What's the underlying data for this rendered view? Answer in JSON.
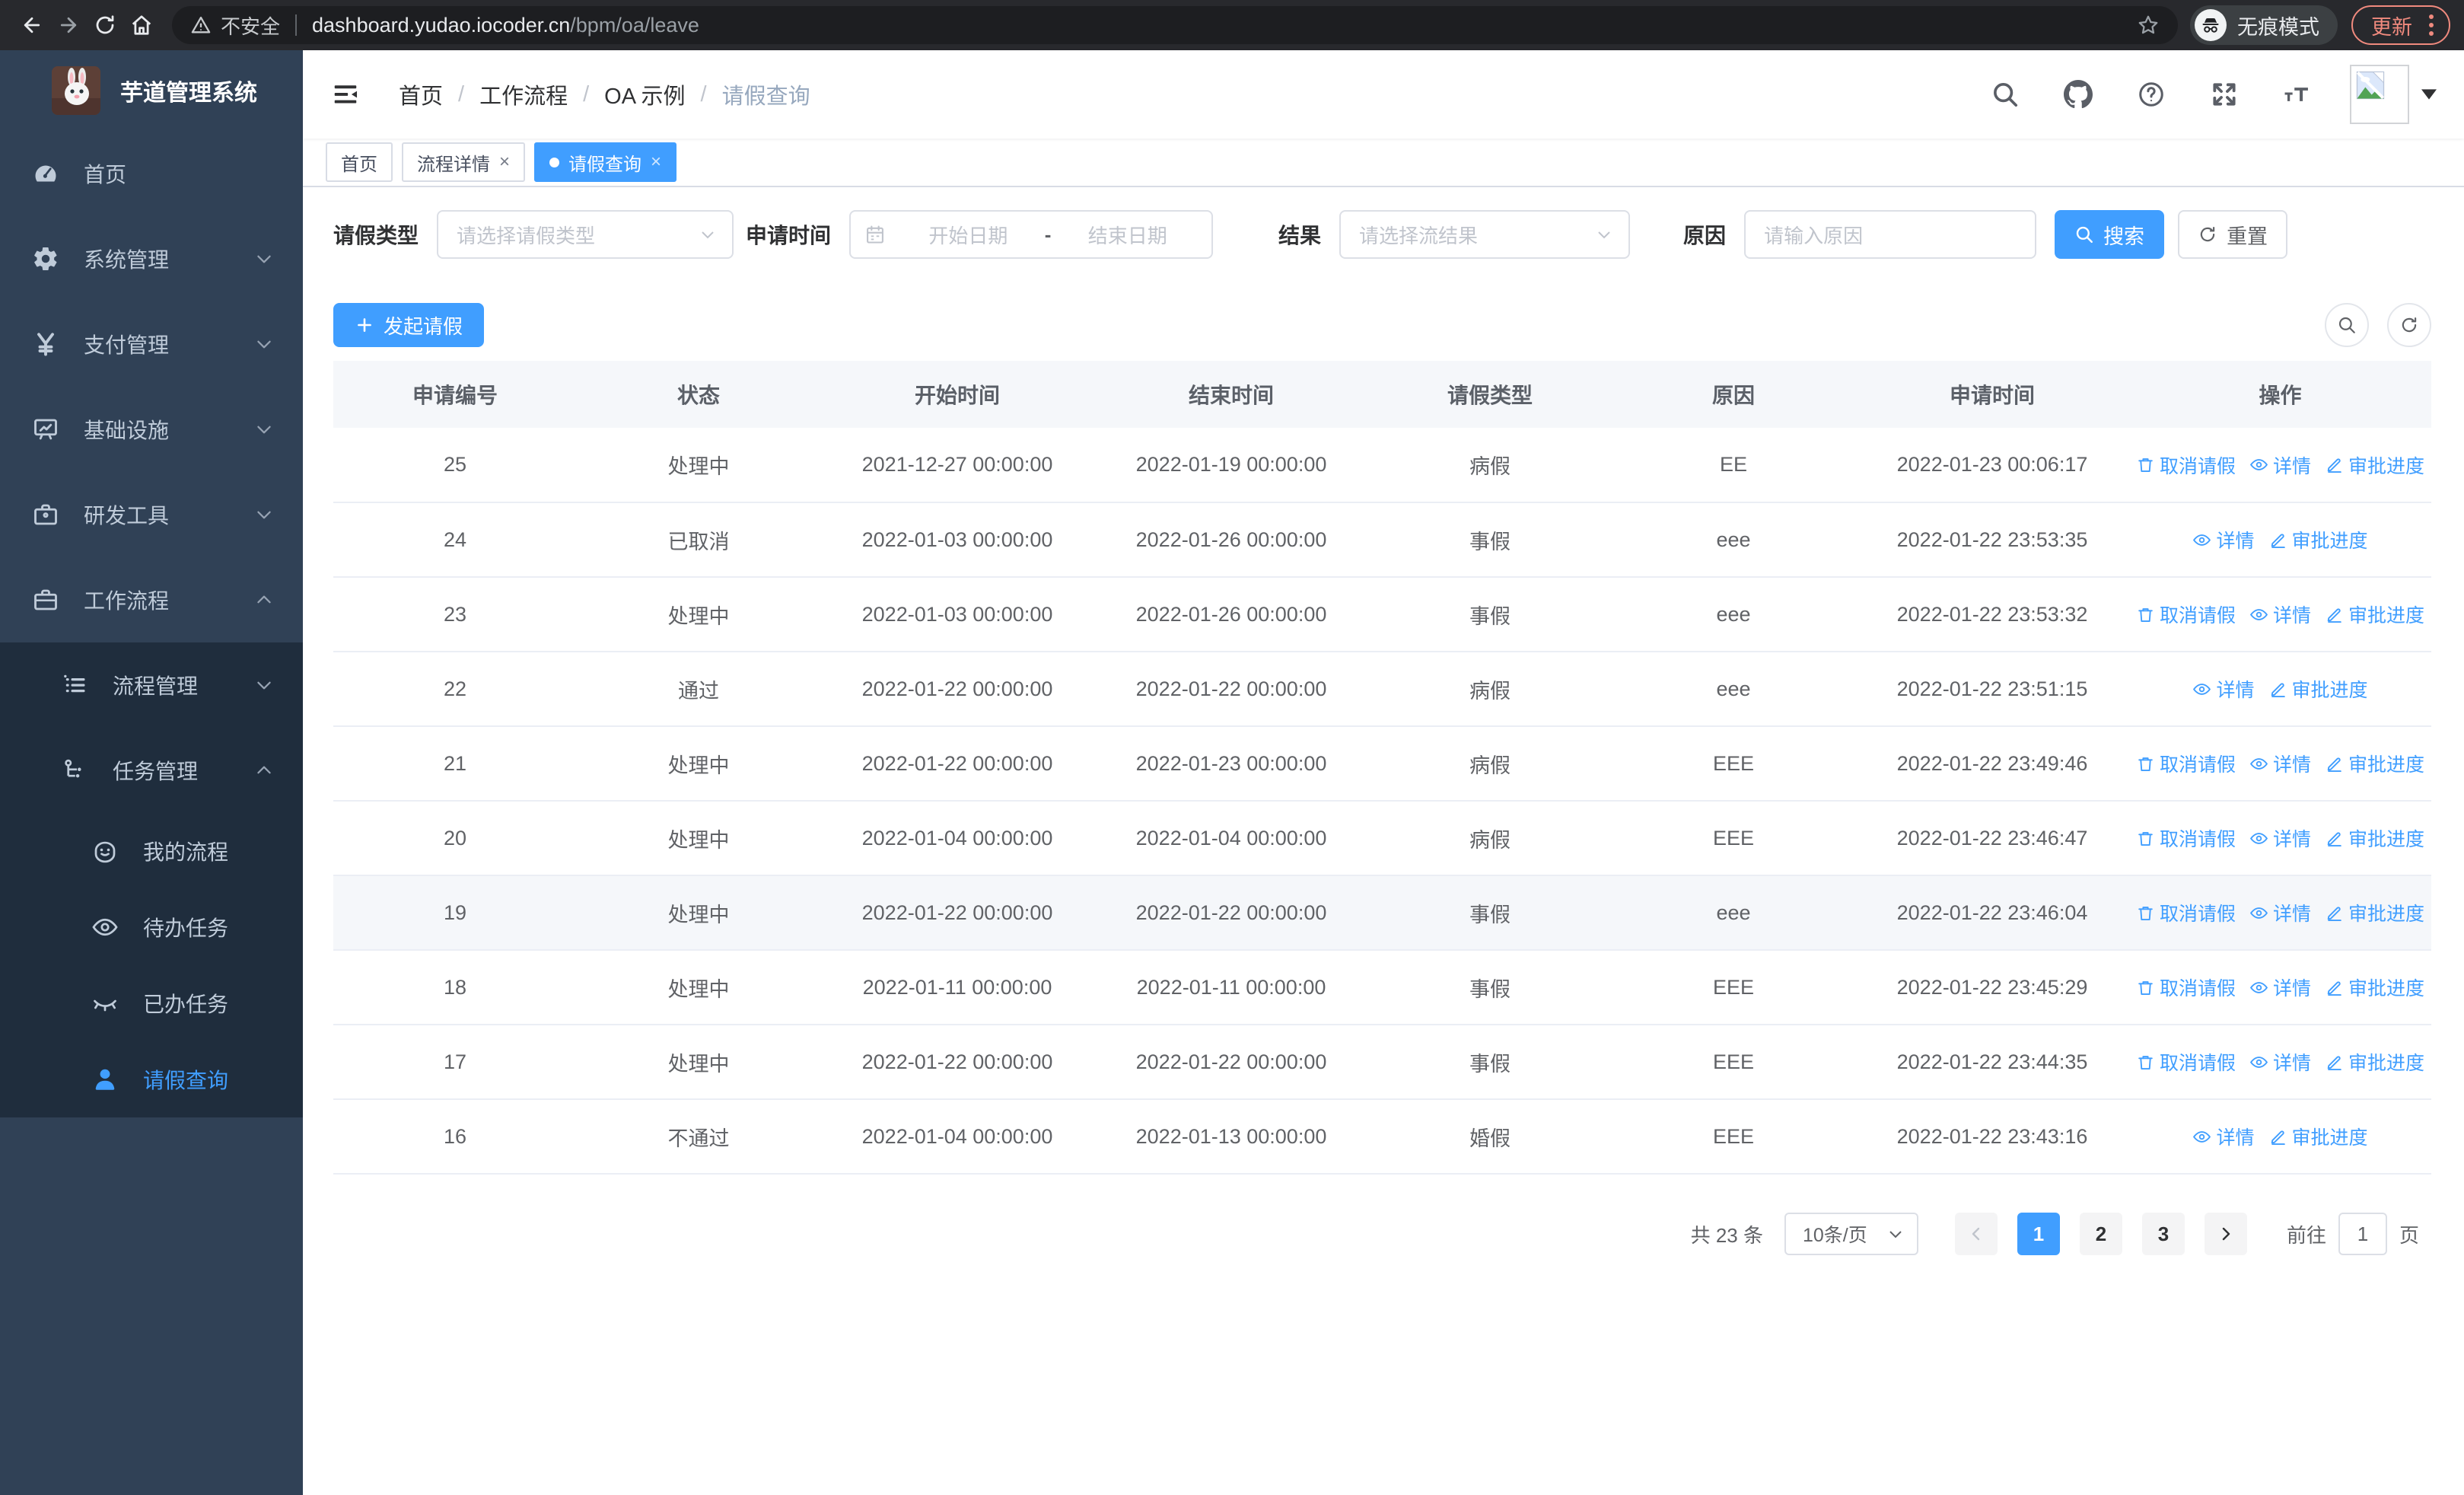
{
  "browser": {
    "security_label": "不安全",
    "url_host": "dashboard.yudao.iocoder.cn",
    "url_path": "/bpm/oa/leave",
    "incognito_label": "无痕模式",
    "update_label": "更新"
  },
  "sidebar": {
    "title": "芋道管理系统",
    "items": [
      {
        "name": "home",
        "label": "首页",
        "icon": "dashboard-icon",
        "level": 1,
        "chevron": null,
        "submenu": false,
        "active": false
      },
      {
        "name": "system",
        "label": "系统管理",
        "icon": "gear-icon",
        "level": 1,
        "chevron": "down",
        "submenu": false,
        "active": false
      },
      {
        "name": "payment",
        "label": "支付管理",
        "icon": "yen-icon",
        "level": 1,
        "chevron": "down",
        "submenu": false,
        "active": false
      },
      {
        "name": "infra",
        "label": "基础设施",
        "icon": "monitor-icon",
        "level": 1,
        "chevron": "down",
        "submenu": false,
        "active": false
      },
      {
        "name": "devtools",
        "label": "研发工具",
        "icon": "toolbox-icon",
        "level": 1,
        "chevron": "down",
        "submenu": false,
        "active": false
      },
      {
        "name": "workflow",
        "label": "工作流程",
        "icon": "briefcase-icon",
        "level": 1,
        "chevron": "up",
        "submenu": false,
        "active": false
      },
      {
        "name": "process-mgmt",
        "label": "流程管理",
        "icon": "list-icon",
        "level": 2,
        "chevron": "down",
        "submenu": true,
        "active": false
      },
      {
        "name": "task-mgmt",
        "label": "任务管理",
        "icon": "flow-icon",
        "level": 2,
        "chevron": "up",
        "submenu": true,
        "active": false
      },
      {
        "name": "my-process",
        "label": "我的流程",
        "icon": "robot-icon",
        "level": 3,
        "chevron": null,
        "submenu": true,
        "active": false
      },
      {
        "name": "todo-tasks",
        "label": "待办任务",
        "icon": "eye-icon",
        "level": 3,
        "chevron": null,
        "submenu": true,
        "active": false
      },
      {
        "name": "done-tasks",
        "label": "已办任务",
        "icon": "eye-closed-icon",
        "level": 3,
        "chevron": null,
        "submenu": true,
        "active": false
      },
      {
        "name": "leave-query",
        "label": "请假查询",
        "icon": "user-icon",
        "level": 3,
        "chevron": null,
        "submenu": true,
        "active": true
      }
    ]
  },
  "header": {
    "breadcrumb": [
      "首页",
      "工作流程",
      "OA 示例",
      "请假查询"
    ]
  },
  "tabs": [
    {
      "name": "home",
      "label": "首页",
      "closable": false,
      "active": false
    },
    {
      "name": "process-detail",
      "label": "流程详情",
      "closable": true,
      "active": false
    },
    {
      "name": "leave-query",
      "label": "请假查询",
      "closable": true,
      "active": true
    }
  ],
  "filters": {
    "type_label": "请假类型",
    "type_placeholder": "请选择请假类型",
    "time_label": "申请时间",
    "start_placeholder": "开始日期",
    "range_separator": "-",
    "end_placeholder": "结束日期",
    "result_label": "结果",
    "result_placeholder": "请选择流结果",
    "reason_label": "原因",
    "reason_placeholder": "请输入原因",
    "search_label": "搜索",
    "reset_label": "重置"
  },
  "toolbar": {
    "create_label": "发起请假"
  },
  "table": {
    "columns": [
      "申请编号",
      "状态",
      "开始时间",
      "结束时间",
      "请假类型",
      "原因",
      "申请时间",
      "操作"
    ],
    "action_defs": {
      "cancel": {
        "label": "取消请假",
        "icon": "delete-icon"
      },
      "detail": {
        "label": "详情",
        "icon": "view-icon"
      },
      "progress": {
        "label": "审批进度",
        "icon": "edit-icon"
      }
    },
    "rows": [
      {
        "id": "25",
        "status": "处理中",
        "start": "2021-12-27 00:00:00",
        "end": "2022-01-19 00:00:00",
        "type": "病假",
        "reason": "EE",
        "apply_time": "2022-01-23 00:06:17",
        "actions": [
          "cancel",
          "detail",
          "progress"
        ],
        "hover": false
      },
      {
        "id": "24",
        "status": "已取消",
        "start": "2022-01-03 00:00:00",
        "end": "2022-01-26 00:00:00",
        "type": "事假",
        "reason": "eee",
        "apply_time": "2022-01-22 23:53:35",
        "actions": [
          "detail",
          "progress"
        ],
        "hover": false
      },
      {
        "id": "23",
        "status": "处理中",
        "start": "2022-01-03 00:00:00",
        "end": "2022-01-26 00:00:00",
        "type": "事假",
        "reason": "eee",
        "apply_time": "2022-01-22 23:53:32",
        "actions": [
          "cancel",
          "detail",
          "progress"
        ],
        "hover": false
      },
      {
        "id": "22",
        "status": "通过",
        "start": "2022-01-22 00:00:00",
        "end": "2022-01-22 00:00:00",
        "type": "病假",
        "reason": "eee",
        "apply_time": "2022-01-22 23:51:15",
        "actions": [
          "detail",
          "progress"
        ],
        "hover": false
      },
      {
        "id": "21",
        "status": "处理中",
        "start": "2022-01-22 00:00:00",
        "end": "2022-01-23 00:00:00",
        "type": "病假",
        "reason": "EEE",
        "apply_time": "2022-01-22 23:49:46",
        "actions": [
          "cancel",
          "detail",
          "progress"
        ],
        "hover": false
      },
      {
        "id": "20",
        "status": "处理中",
        "start": "2022-01-04 00:00:00",
        "end": "2022-01-04 00:00:00",
        "type": "病假",
        "reason": "EEE",
        "apply_time": "2022-01-22 23:46:47",
        "actions": [
          "cancel",
          "detail",
          "progress"
        ],
        "hover": false
      },
      {
        "id": "19",
        "status": "处理中",
        "start": "2022-01-22 00:00:00",
        "end": "2022-01-22 00:00:00",
        "type": "事假",
        "reason": "eee",
        "apply_time": "2022-01-22 23:46:04",
        "actions": [
          "cancel",
          "detail",
          "progress"
        ],
        "hover": true
      },
      {
        "id": "18",
        "status": "处理中",
        "start": "2022-01-11 00:00:00",
        "end": "2022-01-11 00:00:00",
        "type": "事假",
        "reason": "EEE",
        "apply_time": "2022-01-22 23:45:29",
        "actions": [
          "cancel",
          "detail",
          "progress"
        ],
        "hover": false
      },
      {
        "id": "17",
        "status": "处理中",
        "start": "2022-01-22 00:00:00",
        "end": "2022-01-22 00:00:00",
        "type": "事假",
        "reason": "EEE",
        "apply_time": "2022-01-22 23:44:35",
        "actions": [
          "cancel",
          "detail",
          "progress"
        ],
        "hover": false
      },
      {
        "id": "16",
        "status": "不通过",
        "start": "2022-01-04 00:00:00",
        "end": "2022-01-13 00:00:00",
        "type": "婚假",
        "reason": "EEE",
        "apply_time": "2022-01-22 23:43:16",
        "actions": [
          "detail",
          "progress"
        ],
        "hover": false
      }
    ]
  },
  "pagination": {
    "total_label": "共 23 条",
    "page_size": "10条/页",
    "pages": [
      "1",
      "2",
      "3"
    ],
    "current": "1",
    "goto_label": "前往",
    "goto_value": "1",
    "goto_unit": "页"
  },
  "colors": {
    "accent": "#409EFF",
    "sidebar_bg": "#304156",
    "submenu_bg": "#1f2d3d",
    "update_badge": "#f08a7e",
    "table_header_bg": "#f5f7fa"
  }
}
